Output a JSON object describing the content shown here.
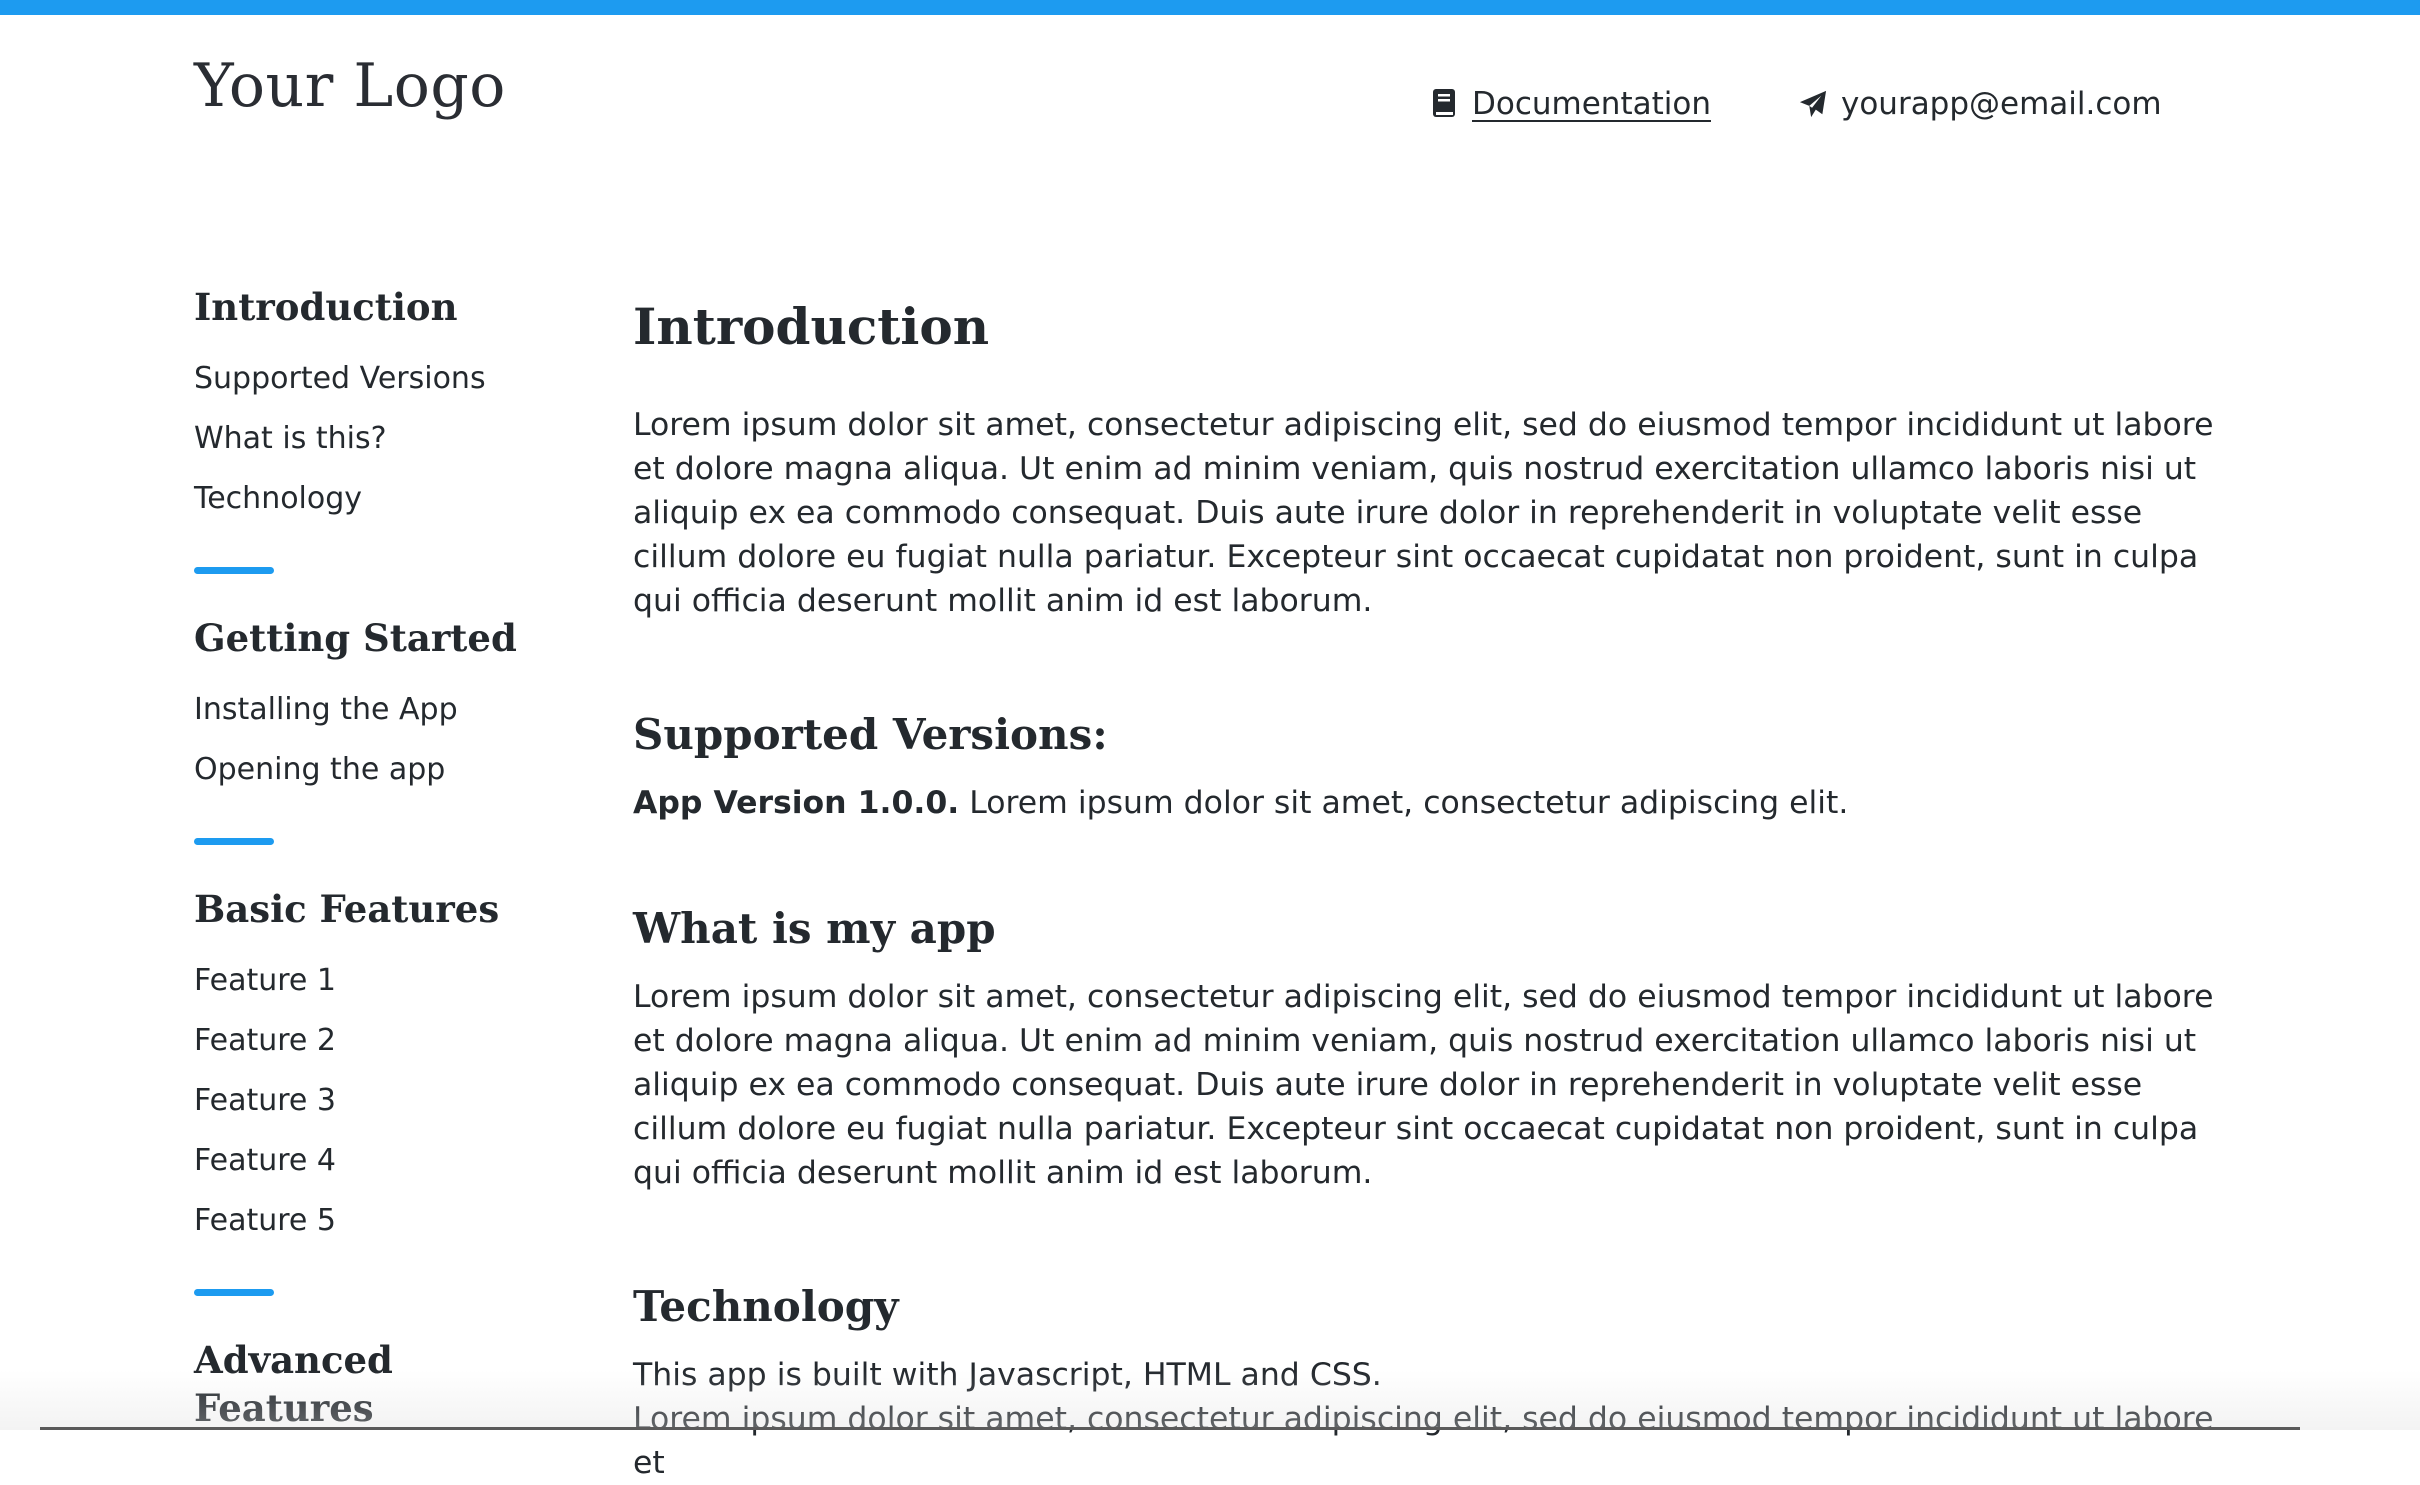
{
  "brand": {
    "logo_text": "Your Logo",
    "accent_color": "#1d9bf0"
  },
  "header": {
    "documentation_label": "Documentation",
    "documentation_icon": "book-icon",
    "email_label": "yourapp@email.com",
    "email_icon": "paper-plane-icon"
  },
  "sidebar": {
    "groups": [
      {
        "title": "Introduction",
        "items": [
          "Supported Versions",
          "What is this?",
          "Technology"
        ]
      },
      {
        "title": "Getting Started",
        "items": [
          "Installing the App",
          "Opening the app"
        ]
      },
      {
        "title": "Basic Features",
        "items": [
          "Feature 1",
          "Feature 2",
          "Feature 3",
          "Feature 4",
          "Feature 5"
        ]
      },
      {
        "title": "Advanced Features",
        "items": []
      }
    ]
  },
  "main": {
    "title": "Introduction",
    "intro_paragraph": "Lorem ipsum dolor sit amet, consectetur adipiscing elit, sed do eiusmod tempor incididunt ut labore et dolore magna aliqua. Ut enim ad minim veniam, quis nostrud exercitation ullamco laboris nisi ut aliquip ex ea commodo consequat. Duis aute irure dolor in reprehenderit in voluptate velit esse cillum dolore eu fugiat nulla pariatur. Excepteur sint occaecat cupidatat non proident, sunt in culpa qui officia deserunt mollit anim id est laborum.",
    "supported_versions": {
      "heading": "Supported Versions:",
      "version_label": "App Version 1.0.0.",
      "version_text": " Lorem ipsum dolor sit amet, consectetur adipiscing elit."
    },
    "what_is": {
      "heading": "What is my app",
      "paragraph": "Lorem ipsum dolor sit amet, consectetur adipiscing elit, sed do eiusmod tempor incididunt ut labore et dolore magna aliqua. Ut enim ad minim veniam, quis nostrud exercitation ullamco laboris nisi ut aliquip ex ea commodo consequat. Duis aute irure dolor in reprehenderit in voluptate velit esse cillum dolore eu fugiat nulla pariatur. Excepteur sint occaecat cupidatat non proident, sunt in culpa qui officia deserunt mollit anim id est laborum."
    },
    "technology": {
      "heading": "Technology",
      "line1": "This app is built with Javascript, HTML and CSS.",
      "line2": "Lorem ipsum dolor sit amet, consectetur adipiscing elit, sed do eiusmod tempor incididunt ut labore et"
    }
  }
}
